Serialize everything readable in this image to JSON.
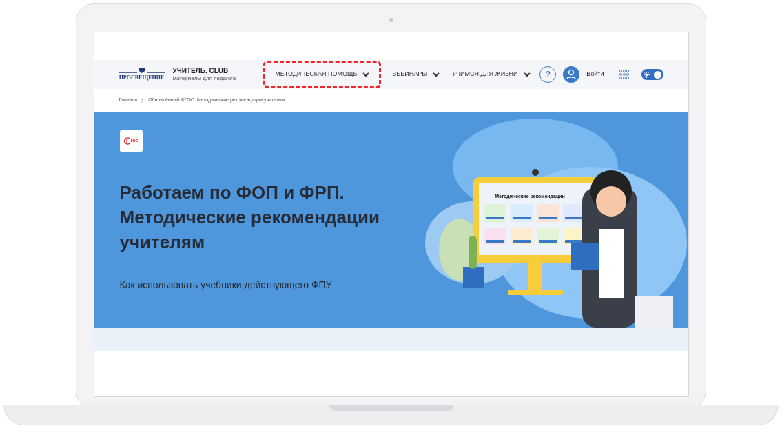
{
  "header": {
    "publisher": "ПРОСВЕЩЕНИЕ",
    "brand": "УЧИТЕЛЬ. CLUB",
    "tagline": "материалы для педагога",
    "nav": [
      {
        "label": "МЕТОДИЧЕСКАЯ ПОМОЩЬ",
        "highlighted": true
      },
      {
        "label": "ВЕБИНАРЫ",
        "highlighted": false
      },
      {
        "label": "УЧИМСЯ ДЛЯ ЖИЗНИ",
        "highlighted": false
      }
    ],
    "help": "?",
    "login": "Войти",
    "theme_toggle": {
      "on": true
    }
  },
  "breadcrumbs": [
    "Главная",
    "Обновлённый ФГОС. Методические рекомендации учителям"
  ],
  "hero": {
    "badge": "гос",
    "title": "Работаем по ФОП и ФРП. Методические рекомендации учителям",
    "subtitle": "Как использовать учебники действующего ФПУ",
    "illustration": {
      "monitor_title": "Методические рекомендации"
    }
  }
}
